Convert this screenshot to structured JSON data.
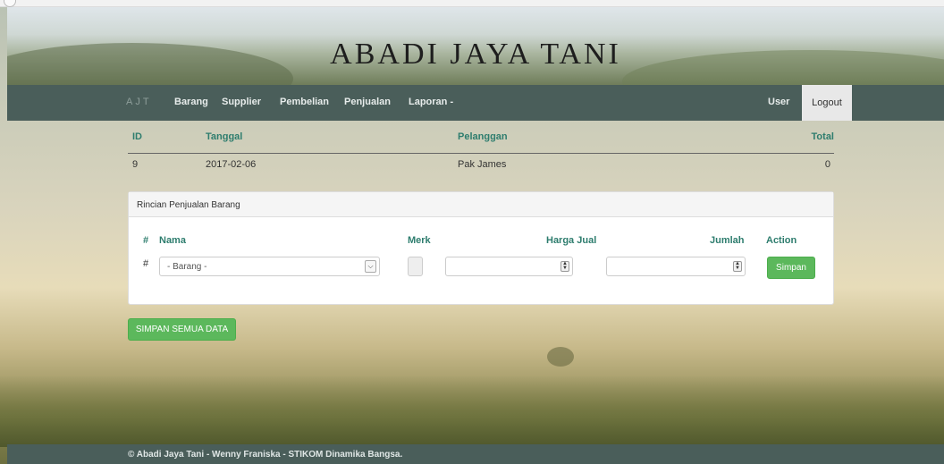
{
  "banner": {
    "title": "ABADI JAYA TANI"
  },
  "navbar": {
    "brand": "AJT",
    "items": [
      "Barang",
      "Supplier",
      "Pembelian",
      "Penjualan",
      "Laporan -"
    ],
    "user": "User",
    "logout": "Logout"
  },
  "summary": {
    "headers": [
      "ID",
      "Tanggal",
      "Pelanggan",
      "Total"
    ],
    "row": [
      "9",
      "2017-02-06",
      "Pak James",
      "0"
    ]
  },
  "detail_panel": {
    "heading": "Rincian Penjualan Barang",
    "headers": [
      "#",
      "Nama",
      "Merk",
      "Harga Jual",
      "Jumlah",
      "Action"
    ],
    "row_marker": "#",
    "barang_select": "- Barang -",
    "save_button": "Simpan"
  },
  "save_all_button": "SIMPAN SEMUA DATA",
  "footer": {
    "text": "© Abadi Jaya Tani - Wenny Franiska - STIKOM Dinamika Bangsa."
  }
}
